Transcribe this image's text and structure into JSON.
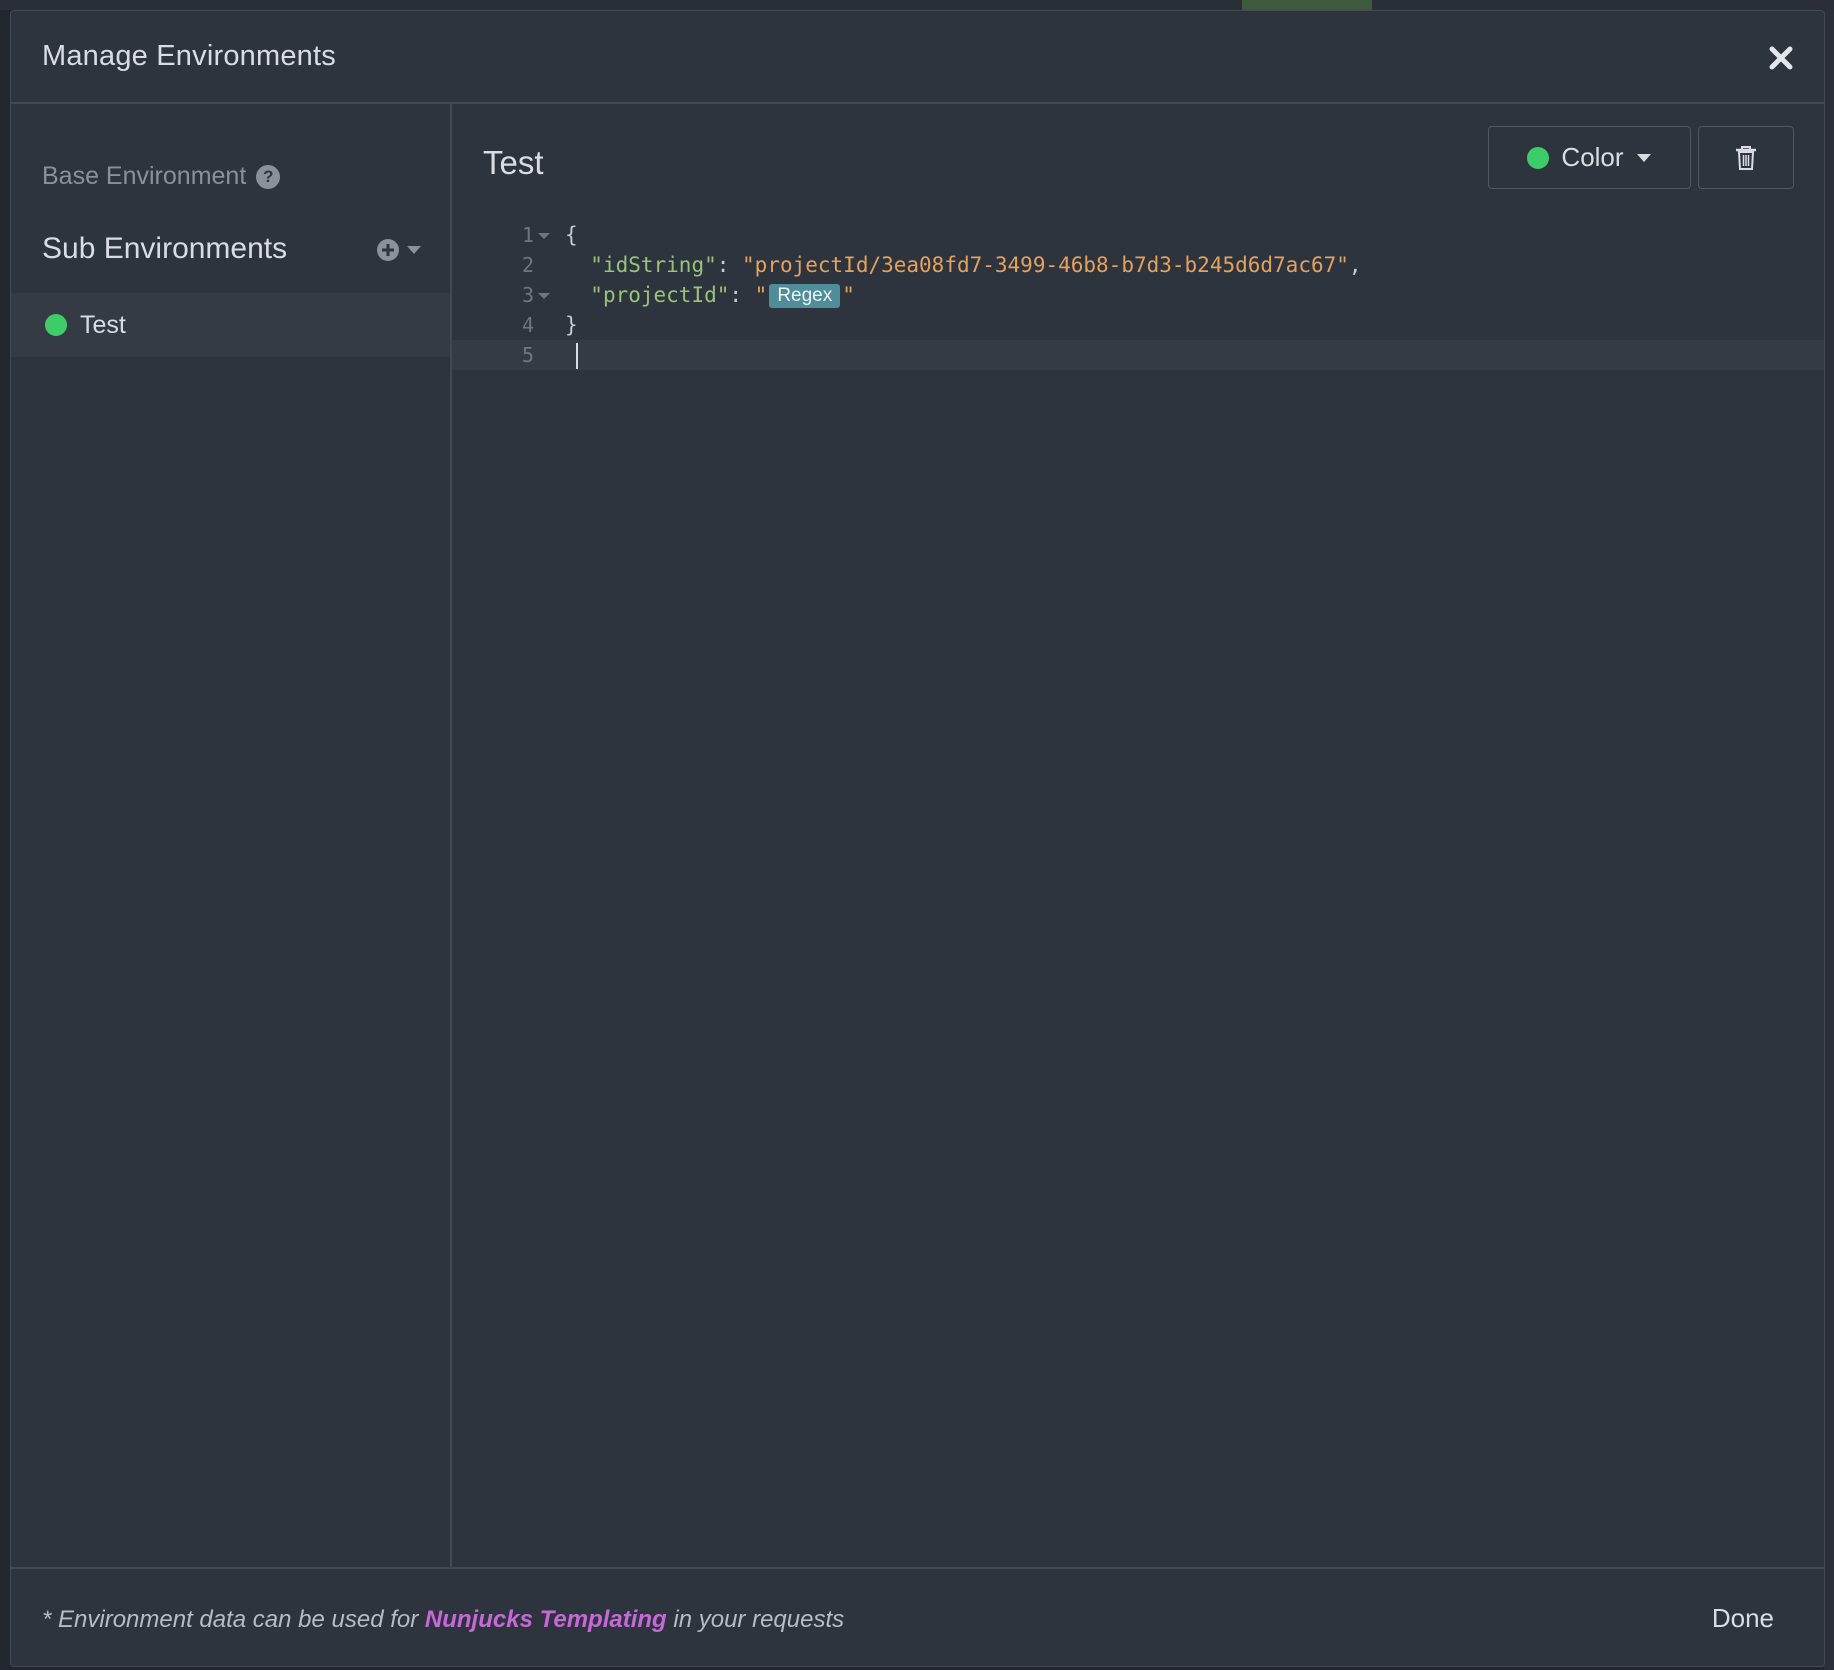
{
  "modal": {
    "title": "Manage Environments",
    "close_icon": "close-icon"
  },
  "sidebar": {
    "base_environment_label": "Base Environment",
    "help_icon": "question-circle-icon",
    "help_glyph": "?",
    "sub_environments_title": "Sub Environments",
    "add_icon": "plus-circle-icon",
    "dropdown_icon": "caret-down-icon",
    "environments": [
      {
        "label": "Test",
        "color": "#3dcc67",
        "selected": true
      }
    ]
  },
  "main": {
    "environment_name": "Test",
    "color_button": {
      "label": "Color",
      "color": "#3dcc67",
      "icon": "caret-down-icon"
    },
    "delete_button": {
      "icon": "trash-icon"
    }
  },
  "editor": {
    "line_numbers": [
      "1",
      "2",
      "3",
      "4",
      "5"
    ],
    "lines": [
      {
        "open": "{"
      },
      {
        "key": "\"idString\"",
        "colon": ": ",
        "value": "\"projectId/3ea08fd7-3499-46b8-b7d3-b245d6d7ac67\"",
        "trail": ","
      },
      {
        "key": "\"projectId\"",
        "colon": ": ",
        "quote_open": "\"",
        "tag": "Regex",
        "quote_close": "\""
      },
      {
        "close": "}"
      },
      {
        "empty": ""
      }
    ],
    "active_line": 5,
    "colors": {
      "key": "#98c379",
      "string": "#e5a15e",
      "tag_bg": "#4f8e99"
    }
  },
  "footer": {
    "note_prefix": "* Environment data can be used for ",
    "note_link": "Nunjucks Templating",
    "note_suffix": " in your requests",
    "done_label": "Done"
  },
  "colors": {
    "background": "#2e343e",
    "accent_link": "#c768d8",
    "env_green": "#3dcc67"
  }
}
